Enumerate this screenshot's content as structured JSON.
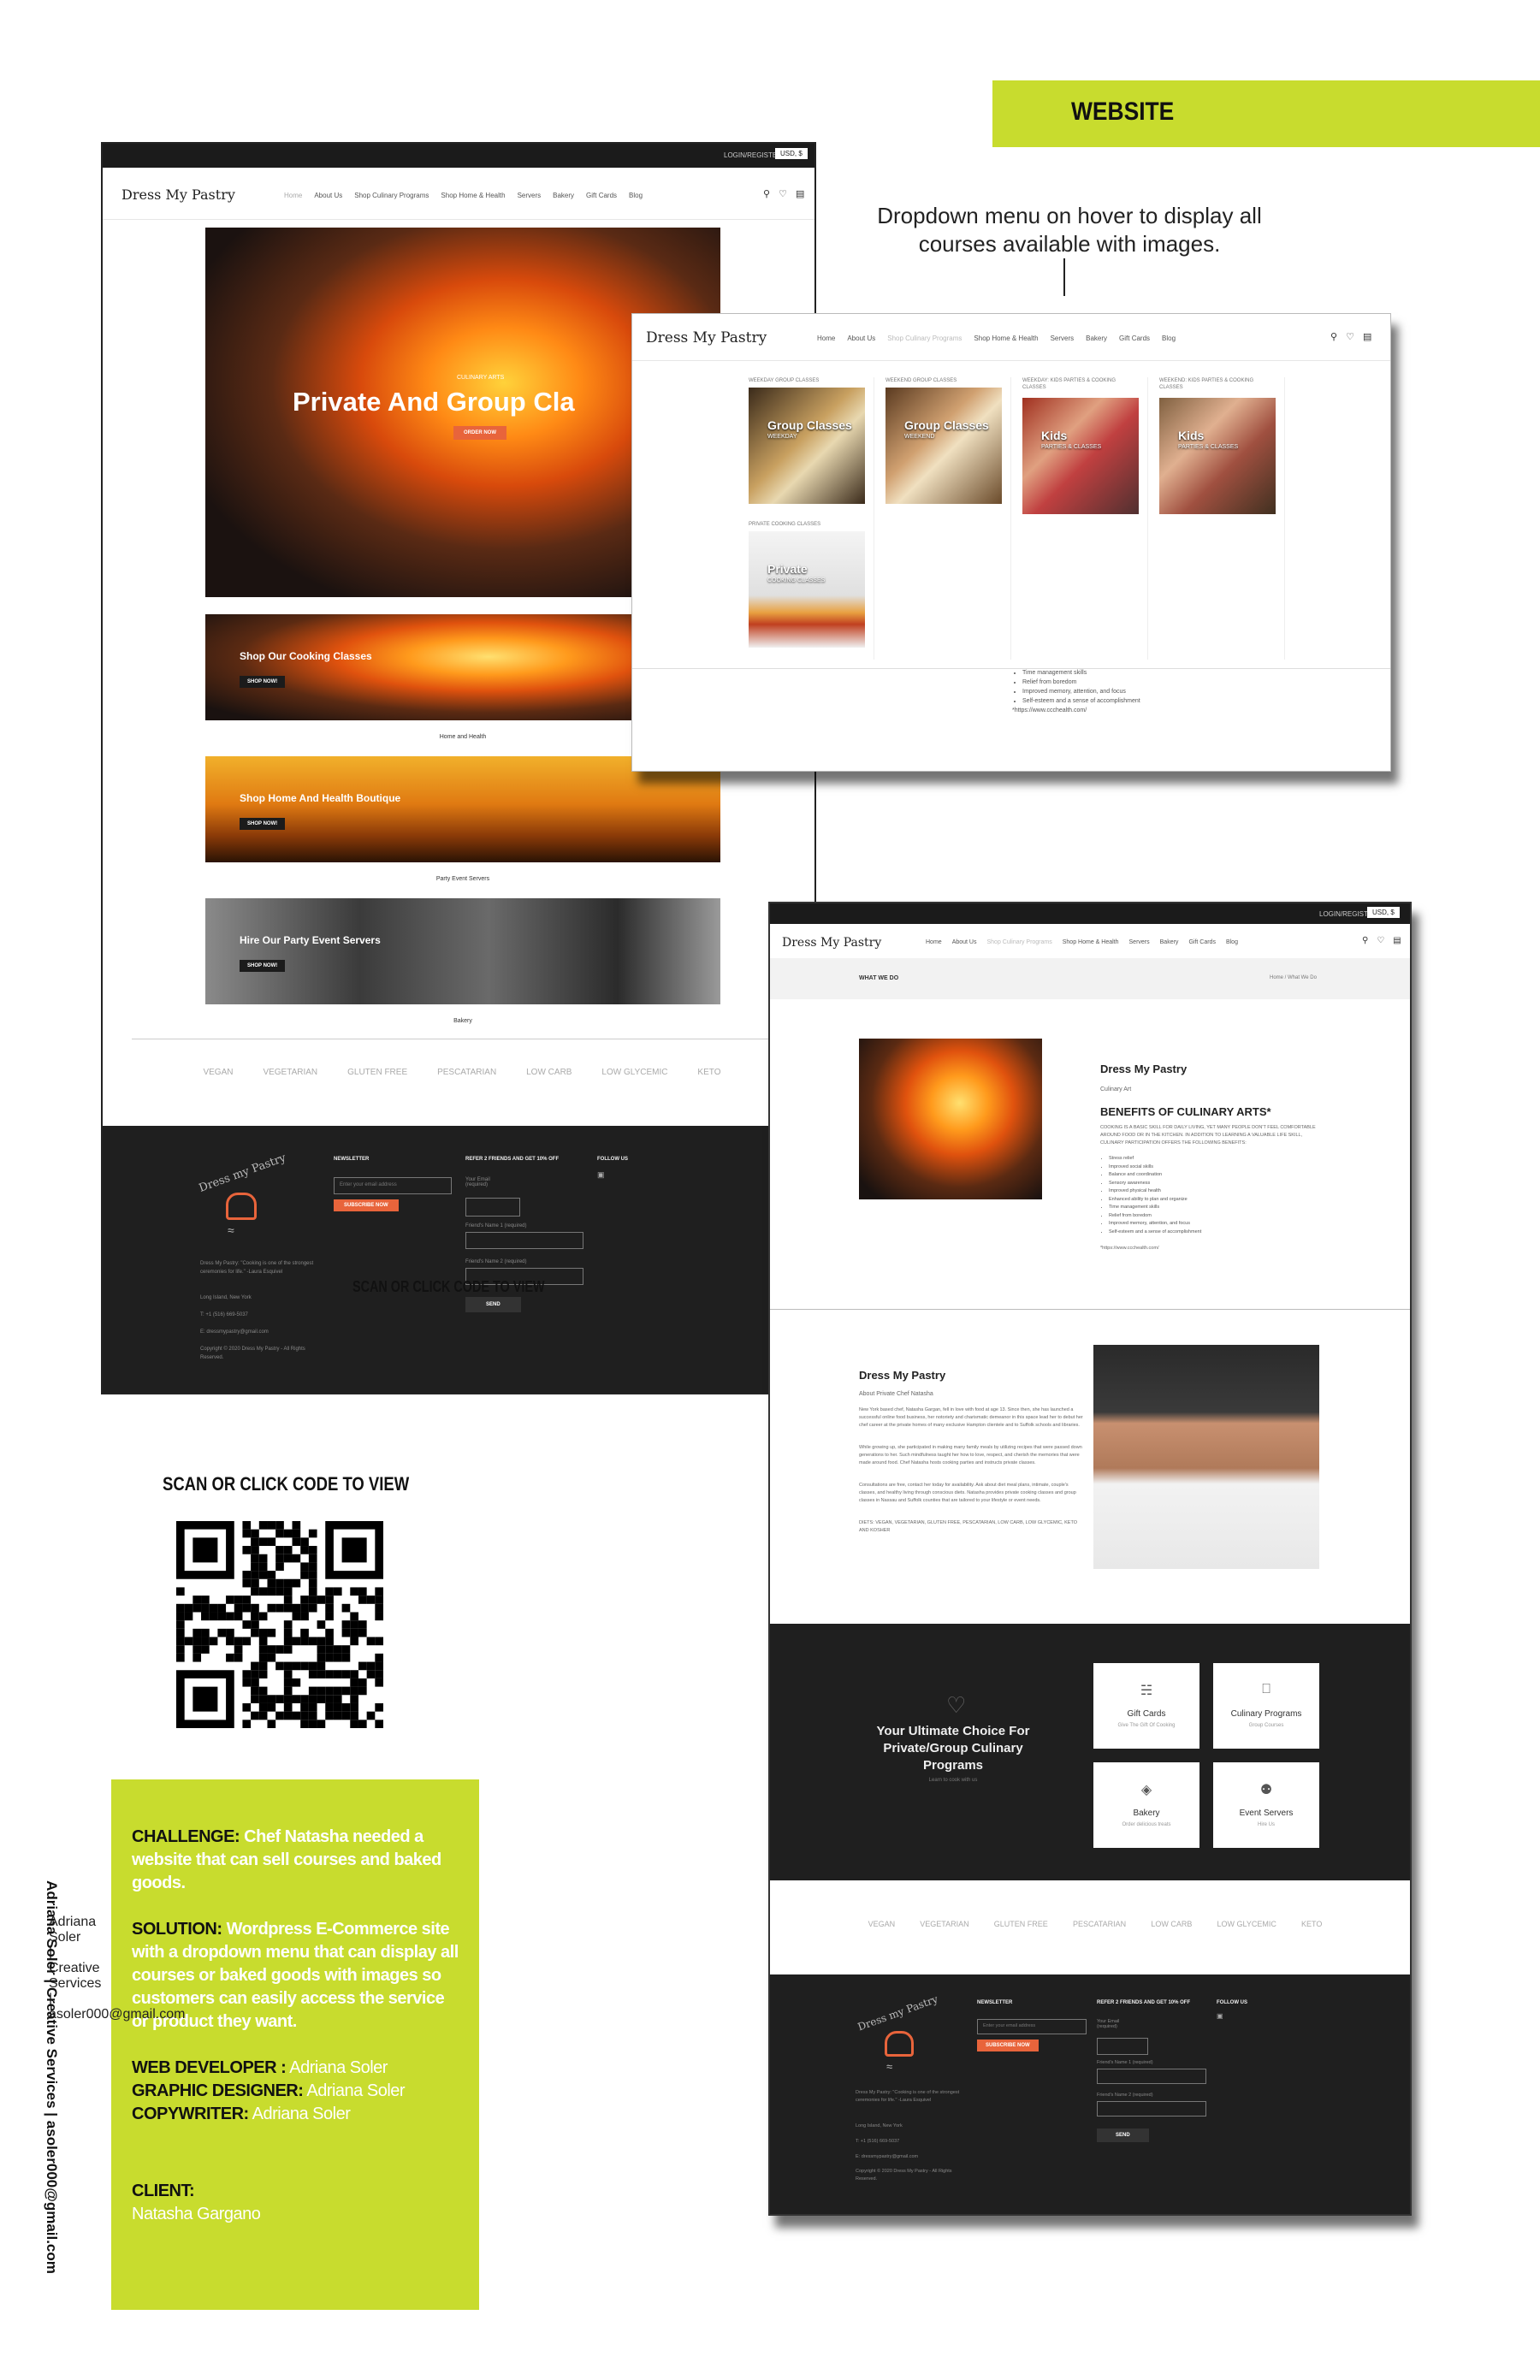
{
  "tag": "WEBSITE",
  "annotation": "Dropdown menu on hover to display all courses available with images.",
  "brand": "Dress My Pastry",
  "account": "LOGIN/REGISTER",
  "currency": "USD, $",
  "nav": [
    "Home",
    "About Us",
    "Shop Culinary Programs",
    "Shop Home & Health",
    "Servers",
    "Bakery",
    "Gift Cards",
    "Blog"
  ],
  "home": {
    "hero_kicker": "CULINARY ARTS",
    "hero_title": "Private And Group Cla",
    "hero_button": "ORDER NOW",
    "banners": [
      {
        "title": "Shop Our Cooking Classes",
        "button": "SHOP NOW!",
        "caption": "Home and Health"
      },
      {
        "title": "Shop Home And Health Boutique",
        "button": "SHOP NOW!",
        "caption": "Party Event Servers"
      },
      {
        "title": "Hire Our Party Event Servers",
        "button": "SHOP NOW!",
        "caption": "Bakery"
      }
    ],
    "scan_overlay": "SCAN OR CLICK CODE TO VIEW"
  },
  "diet_tags": [
    "VEGAN",
    "VEGETARIAN",
    "GLUTEN FREE",
    "PESCATARIAN",
    "LOW CARB",
    "LOW GLYCEMIC",
    "KETO"
  ],
  "footer": {
    "logo_text": "Dress my Pastry",
    "quote": "Dress My Pastry: \"Cooking is one of the strongest ceremonies for life.\" -Laura Esquivel",
    "location": "Long Island, New York",
    "phone": "T: +1 (516) 669-5037",
    "email": "E: dressmypastry@gmail.com",
    "copyright": "Copyright © 2020 Dress My Pastry - All Rights Reserved.",
    "newsletter_head": "NEWSLETTER",
    "newsletter_placeholder": "Enter your email address",
    "subscribe": "SUBSCRIBE NOW",
    "refer_head": "REFER 2 FRIENDS AND GET 10% OFF",
    "your_email": "Your Email (required)",
    "friend1": "Friend's Name 1 (required)",
    "friend2": "Friend's Name 2 (required)",
    "send": "SEND",
    "follow_head": "FOLLOW US"
  },
  "dropdown": {
    "items": [
      {
        "category": "WEEKDAY GROUP CLASSES",
        "title": "Group Classes",
        "sub": "WEEKDAY"
      },
      {
        "category": "WEEKEND GROUP CLASSES",
        "title": "Group Classes",
        "sub": "WEEKEND"
      },
      {
        "category": "WEEKDAY: KIDS PARTIES & COOKING CLASSES",
        "title": "Kids",
        "sub": "PARTIES & CLASSES"
      },
      {
        "category": "WEEKEND: KIDS PARTIES & COOKING CLASSES",
        "title": "Kids",
        "sub": "PARTIES & CLASSES"
      },
      {
        "category": "PRIVATE COOKING CLASSES",
        "title": "Private",
        "sub": "COOKING CLASSES"
      }
    ],
    "bullets": [
      "Time management skills",
      "Relief from boredom",
      "Improved memory, attention, and focus",
      "Self-esteem and a sense of accomplishment"
    ],
    "source": "*https://www.ccchealth.com/"
  },
  "about": {
    "breadcrumb_title": "WHAT WE DO",
    "breadcrumb_path": "Home / What We Do",
    "heading": "Dress My Pastry",
    "kicker": "Culinary Art",
    "benefits_title": "BENEFITS OF CULINARY ARTS*",
    "benefits_intro": "COOKING IS A BASIC SKILL FOR DAILY LIVING, YET MANY PEOPLE DON'T FEEL COMFORTABLE AROUND FOOD OR IN THE KITCHEN. IN ADDITION TO LEARNING A VALUABLE LIFE SKILL, CULINARY PARTICIPATION OFFERS THE FOLLOWING BENEFITS:",
    "benefits": [
      "Stress relief",
      "Improved social skills",
      "Balance and coordination",
      "Sensory awareness",
      "Improved physical health",
      "Enhanced ability to plan and organize",
      "Time management skills",
      "Relief from boredom",
      "Improved memory, attention, and focus",
      "Self-esteem and a sense of accomplishment"
    ],
    "source": "*https://www.ccchealth.com/",
    "chef_heading": "Dress My Pastry",
    "chef_kicker": "About Private Chef Natasha",
    "chef_p1": "New York based chef, Natasha Gargan, fell in love with food at age 13. Since then, she has launched a successful online food business, her notoriety and charismatic demeanor in this space lead her to debut her chef career at the private homes of many exclusive Hampton clientele and to Suffolk schools and libraries.",
    "chef_p2": "While growing up, she participated in making many family meals by utilizing recipes that were passed down generations to her. Such mindfulness taught her how to love, respect, and cherish the memories that were made around food. Chef Natasha hosts cooking parties and instructs private classes.",
    "chef_p3": "Consultations are free, contact her today for availability. Ask about diet meal plans, intimate, couple's classes, and healthy living through conscious diets. Natasha provides private cooking classes and group classes in Nassau and Suffolk counties that are tailored to your lifestyle or event needs.",
    "chef_p4": "DIETS: VEGAN, VEGETARIAN, GLUTEN FREE, PESCATARIAN, LOW CARB, LOW GLYCEMIC, KETO AND KOSHER",
    "choice_title": "Your Ultimate Choice For Private/Group Culinary Programs",
    "choice_sub": "Learn to cook with us",
    "tiles": [
      {
        "icon": "gift-icon",
        "label": "Gift Cards",
        "sub": "Give The Gift Of Cooking"
      },
      {
        "icon": "pot-icon",
        "label": "Culinary Programs",
        "sub": "Group Courses"
      },
      {
        "icon": "cake-icon",
        "label": "Bakery",
        "sub": "Order delicious treats"
      },
      {
        "icon": "server-icon",
        "label": "Event Servers",
        "sub": "Hire Us"
      }
    ]
  },
  "qr_label": "SCAN OR CLICK CODE TO VIEW",
  "case": {
    "challenge_label": "CHALLENGE:",
    "challenge": "Chef Natasha needed a website that can sell courses and baked goods.",
    "solution_label": "SOLUTION:",
    "solution": "Wordpress E-Commerce site with a dropdown menu that can display all courses or baked goods with images so customers can easily access the service or product they want.",
    "webdev_label": "WEB DEVELOPER :",
    "webdev": "Adriana Soler",
    "designer_label": "GRAPHIC DESIGNER:",
    "designer": "Adriana Soler",
    "copy_label": "COPYWRITER:",
    "copy": "Adriana Soler",
    "client_label": "CLIENT:",
    "client": "Natasha Gargano"
  },
  "credit": "Adriana Soler | Creative Services | asoler000@gmail.com",
  "colors": {
    "accent": "#c8dc2e",
    "orange": "#e8643b",
    "dark": "#1f1f1f"
  }
}
